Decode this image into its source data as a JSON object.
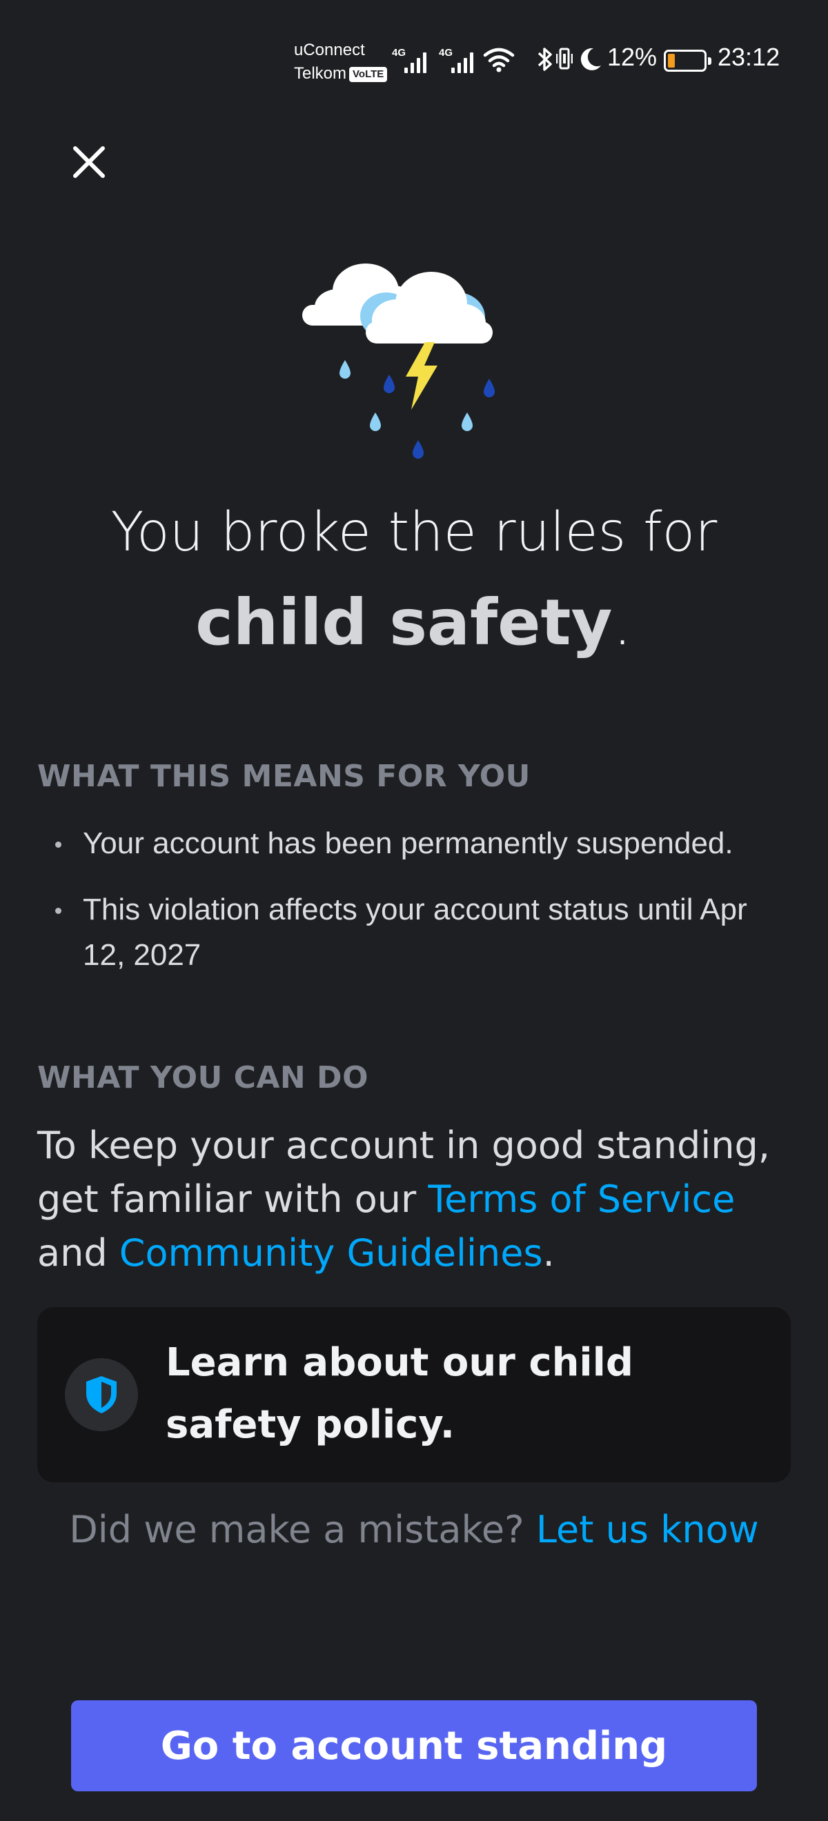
{
  "status_bar": {
    "carrier_1": "uConnect",
    "carrier_2": "Telkom",
    "volte": "VoLTE",
    "net_1": "4G",
    "net_2": "4G",
    "battery_percent": "12%",
    "battery_level": 0.12,
    "time": "23:12",
    "icons": [
      "wifi-icon",
      "bluetooth-icon",
      "vibrate-icon",
      "do-not-disturb-moon-icon",
      "battery-icon"
    ]
  },
  "header": {
    "close_icon": "close-icon"
  },
  "illustration": {
    "name": "storm-cloud-illustration",
    "colors": {
      "cloud": "#ffffff",
      "cloud_shadow": "#8fd0f5",
      "bolt": "#f5e04a",
      "drop_light": "#8fd0f5",
      "drop_dark": "#1d49b8"
    }
  },
  "headline": {
    "line1": "You broke the rules for",
    "emphasis": "child safety",
    "period": "."
  },
  "what_this_means": {
    "label": "WHAT THIS MEANS FOR YOU",
    "items": [
      "Your account has been permanently suspended.",
      "This violation affects your account status until Apr 12, 2027"
    ]
  },
  "what_you_can_do": {
    "label": "WHAT YOU CAN DO",
    "text_before": "To keep your account in good standing, get familiar with our ",
    "tos_link": "Terms of Service",
    "text_middle": " and ",
    "guidelines_link": "Community Guidelines",
    "text_after": "."
  },
  "policy_card": {
    "label": "Learn about our child safety policy.",
    "icon": "shield-icon"
  },
  "mistake": {
    "text": "Did we make a mistake? ",
    "link": "Let us know"
  },
  "primary_button": {
    "label": "Go to account standing"
  },
  "colors": {
    "background": "#1e1f22",
    "link": "#00a8fc",
    "button": "#5865f2",
    "card": "#141417"
  }
}
